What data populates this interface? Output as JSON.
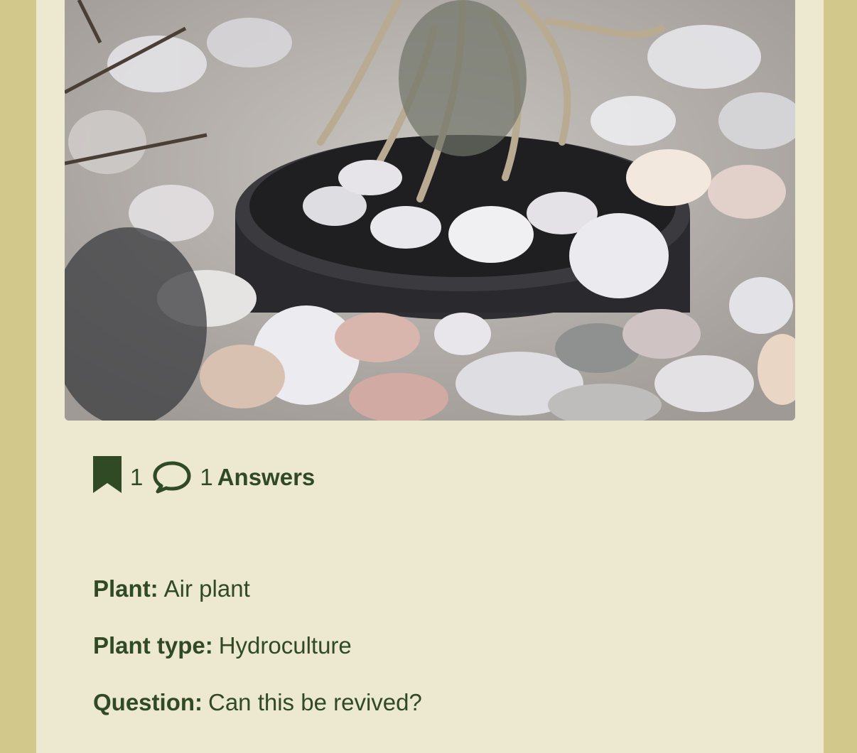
{
  "photo": {
    "alt_icon": "plant-photo"
  },
  "stats": {
    "bookmark_icon": "bookmark-icon",
    "bookmark_count": "1",
    "comment_icon": "speech-bubble-icon",
    "answers_count": "1",
    "answers_label": "Answers"
  },
  "details": {
    "plant_label": "Plant:",
    "plant_value": "Air plant",
    "type_label": "Plant type:",
    "type_value": "Hydroculture",
    "question_label": "Question:",
    "question_value": "Can this be revived?"
  },
  "colors": {
    "page_bg": "#d3c88b",
    "card_bg": "#ede8d0",
    "accent": "#2f4a24"
  }
}
